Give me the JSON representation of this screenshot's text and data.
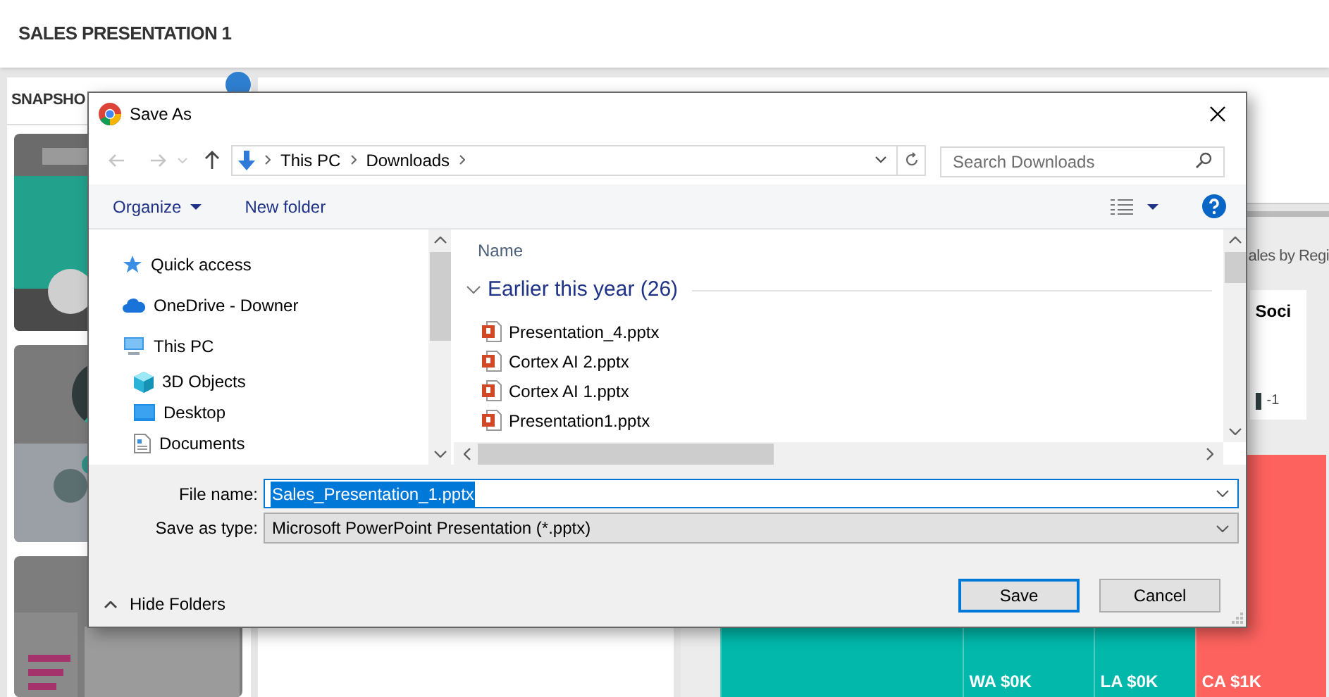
{
  "app": {
    "title": "SALES PRESENTATION 1",
    "snapshots_heading": "SNAPSHO"
  },
  "dashboard": {
    "panel_title": "ales by Regi",
    "card_title": "Soci",
    "card_value": "-1",
    "treemap": [
      {
        "color": "#01b8aa"
      },
      {
        "label": "WA $0K",
        "color": "#01b8aa"
      },
      {
        "label": "LA $0K",
        "color": "#01b8aa"
      },
      {
        "label": "CA $1K",
        "color": "#fd625e"
      }
    ]
  },
  "dialog": {
    "title": "Save As",
    "breadcrumb": [
      "This PC",
      "Downloads"
    ],
    "search": {
      "placeholder": "Search Downloads"
    },
    "toolbar": {
      "organize": "Organize",
      "new_folder": "New folder"
    },
    "nav_tree": [
      {
        "label": "Quick access",
        "kind": "star"
      },
      {
        "label": "OneDrive - Downer",
        "kind": "cloud"
      },
      {
        "label": "This PC",
        "kind": "computer",
        "children": [
          {
            "label": "3D Objects",
            "kind": "cube"
          },
          {
            "label": "Desktop",
            "kind": "desktop"
          },
          {
            "label": "Documents",
            "kind": "document"
          }
        ]
      }
    ],
    "column_header": "Name",
    "group": {
      "label": "Earlier this year (26)",
      "expanded": true
    },
    "files": [
      "Presentation_4.pptx",
      "Cortex AI 2.pptx",
      "Cortex AI 1.pptx",
      "Presentation1.pptx"
    ],
    "file_name": {
      "label": "File name:",
      "value": "Sales_Presentation_1.pptx",
      "selected": true
    },
    "save_type": {
      "label": "Save as type:",
      "value": "Microsoft PowerPoint Presentation (*.pptx)"
    },
    "hide_folders": "Hide Folders",
    "buttons": [
      {
        "label": "Save",
        "default": true
      },
      {
        "label": "Cancel",
        "default": false
      }
    ]
  }
}
